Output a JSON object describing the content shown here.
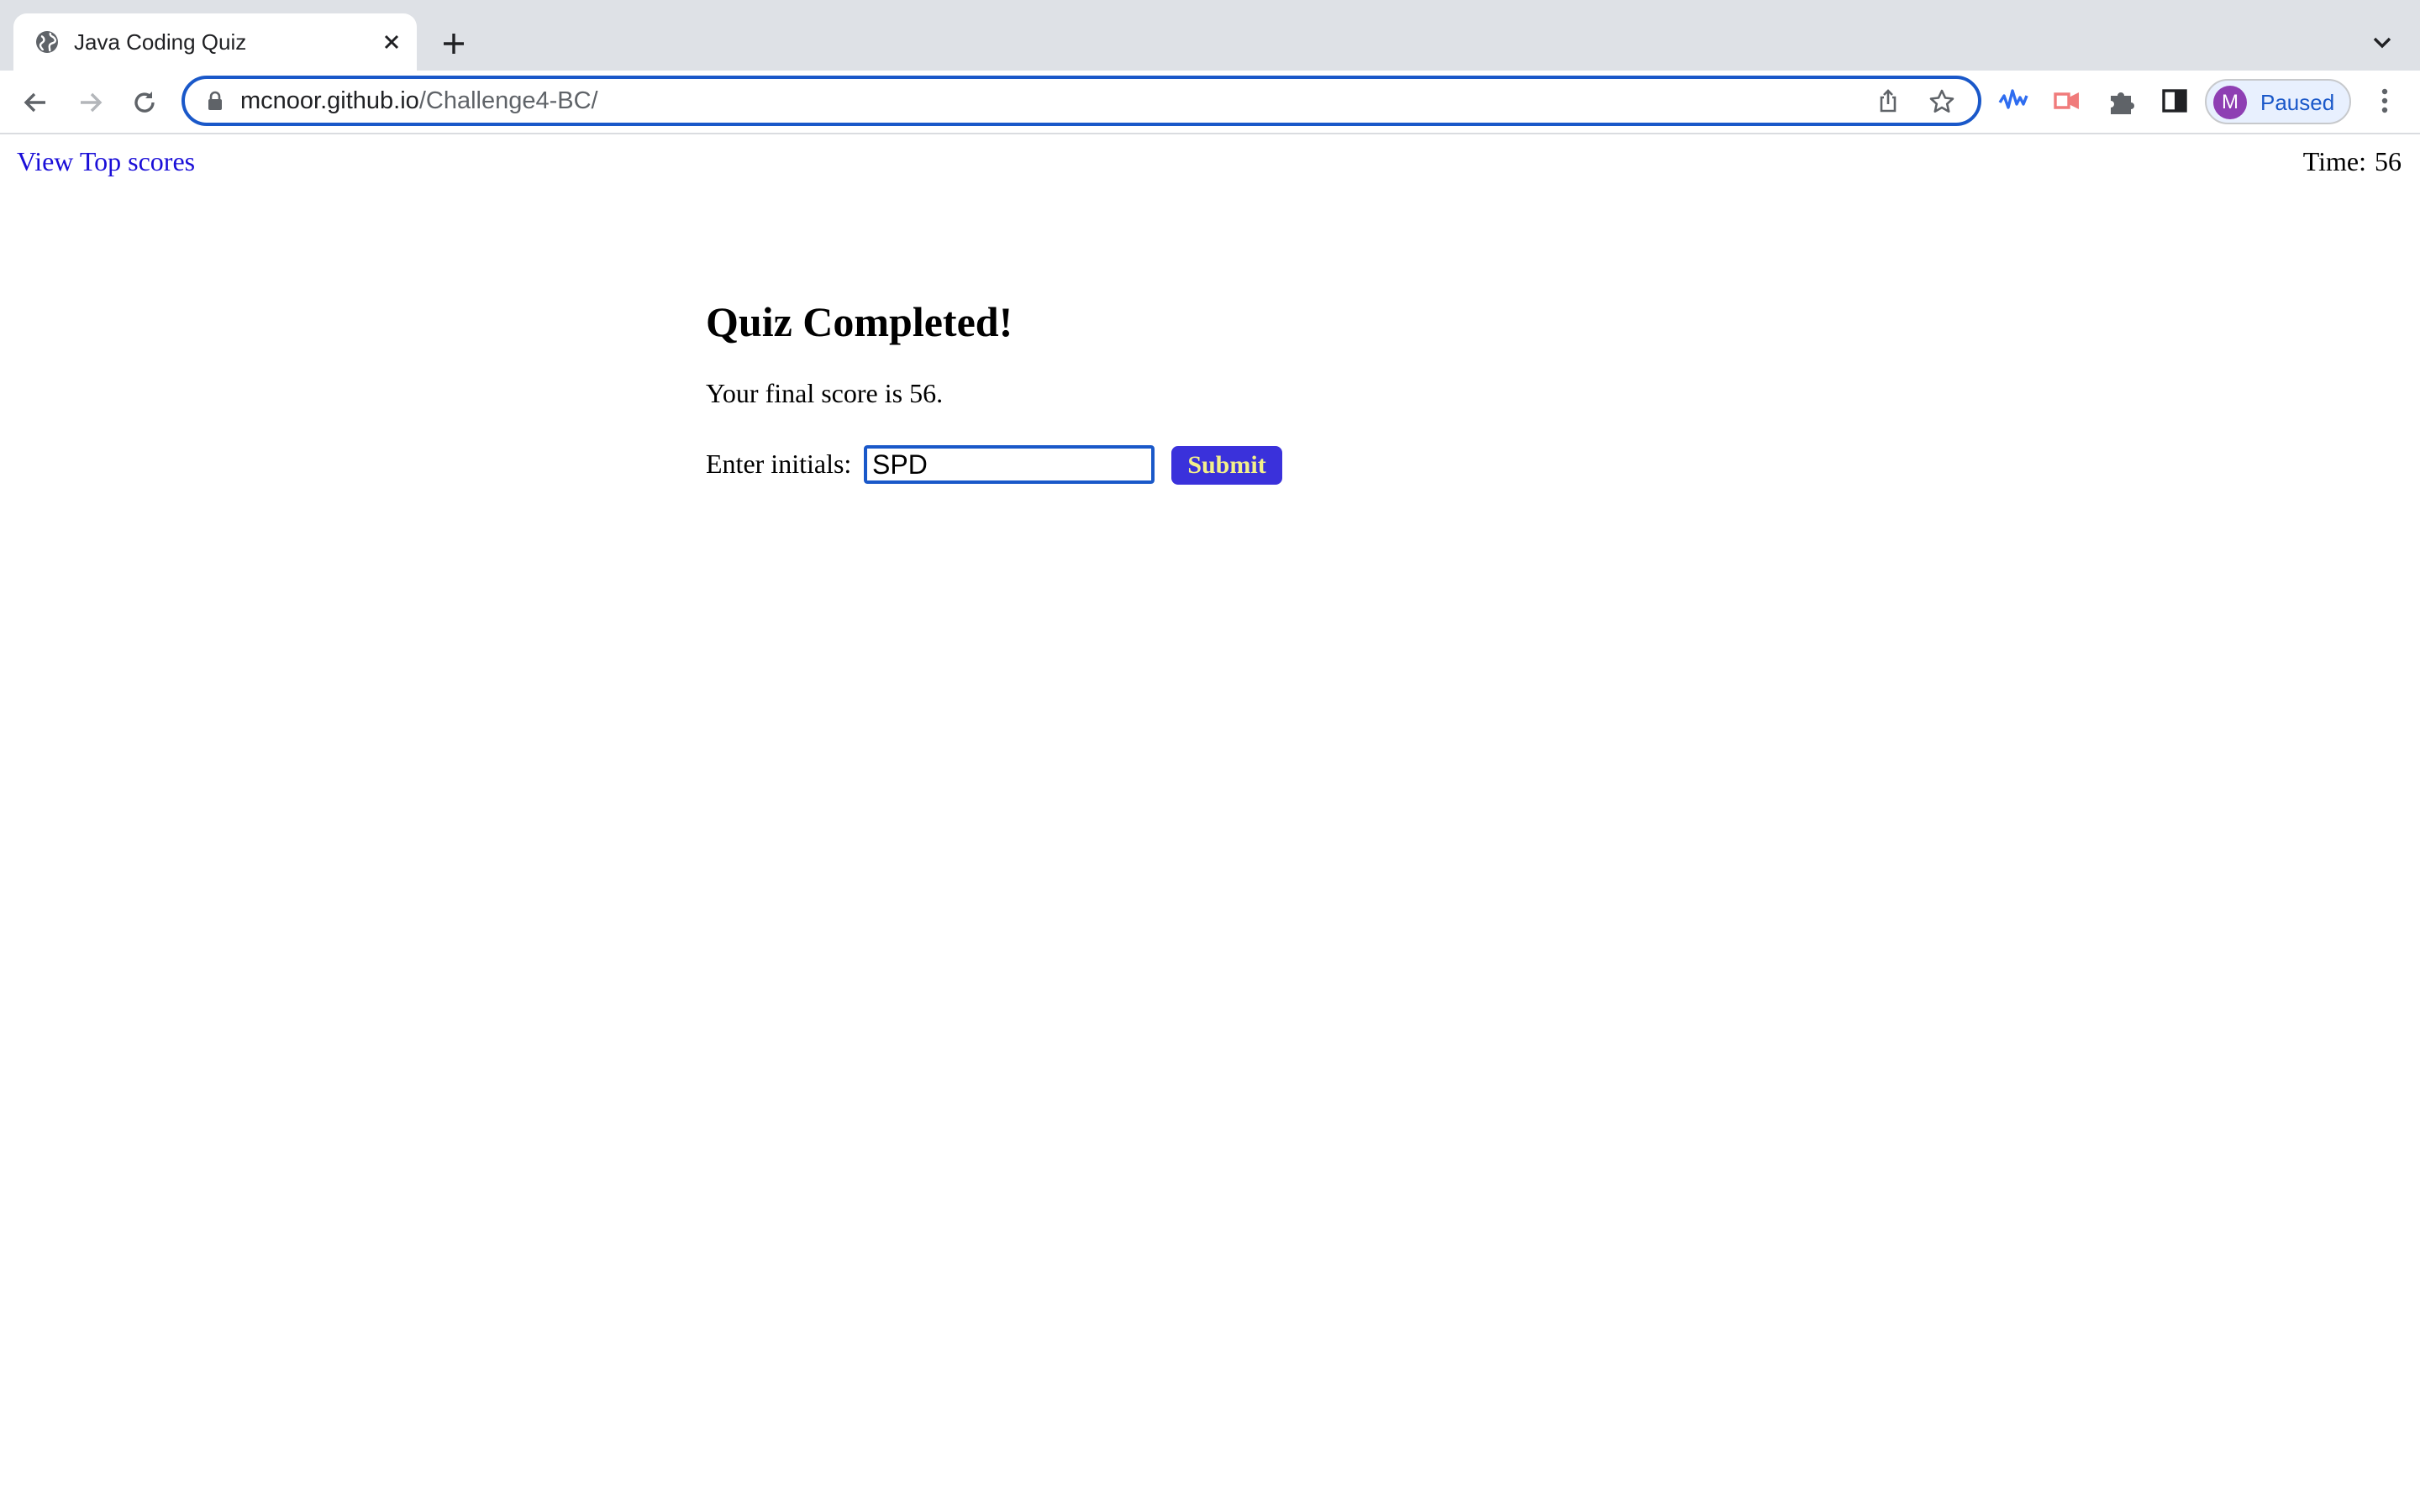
{
  "browser": {
    "tab_title": "Java Coding Quiz",
    "url_host": "mcnoor.github.io",
    "url_path": "/Challenge4-BC/",
    "profile_initial": "M",
    "profile_status": "Paused"
  },
  "quiz": {
    "view_scores_link": "View Top scores",
    "timer_label": "Time:",
    "timer_value": "56",
    "heading": "Quiz Completed!",
    "final_score_text": "Your final score is 56.",
    "initials_label": "Enter initials:",
    "initials_value": "SPD",
    "submit_label": "Submit"
  }
}
